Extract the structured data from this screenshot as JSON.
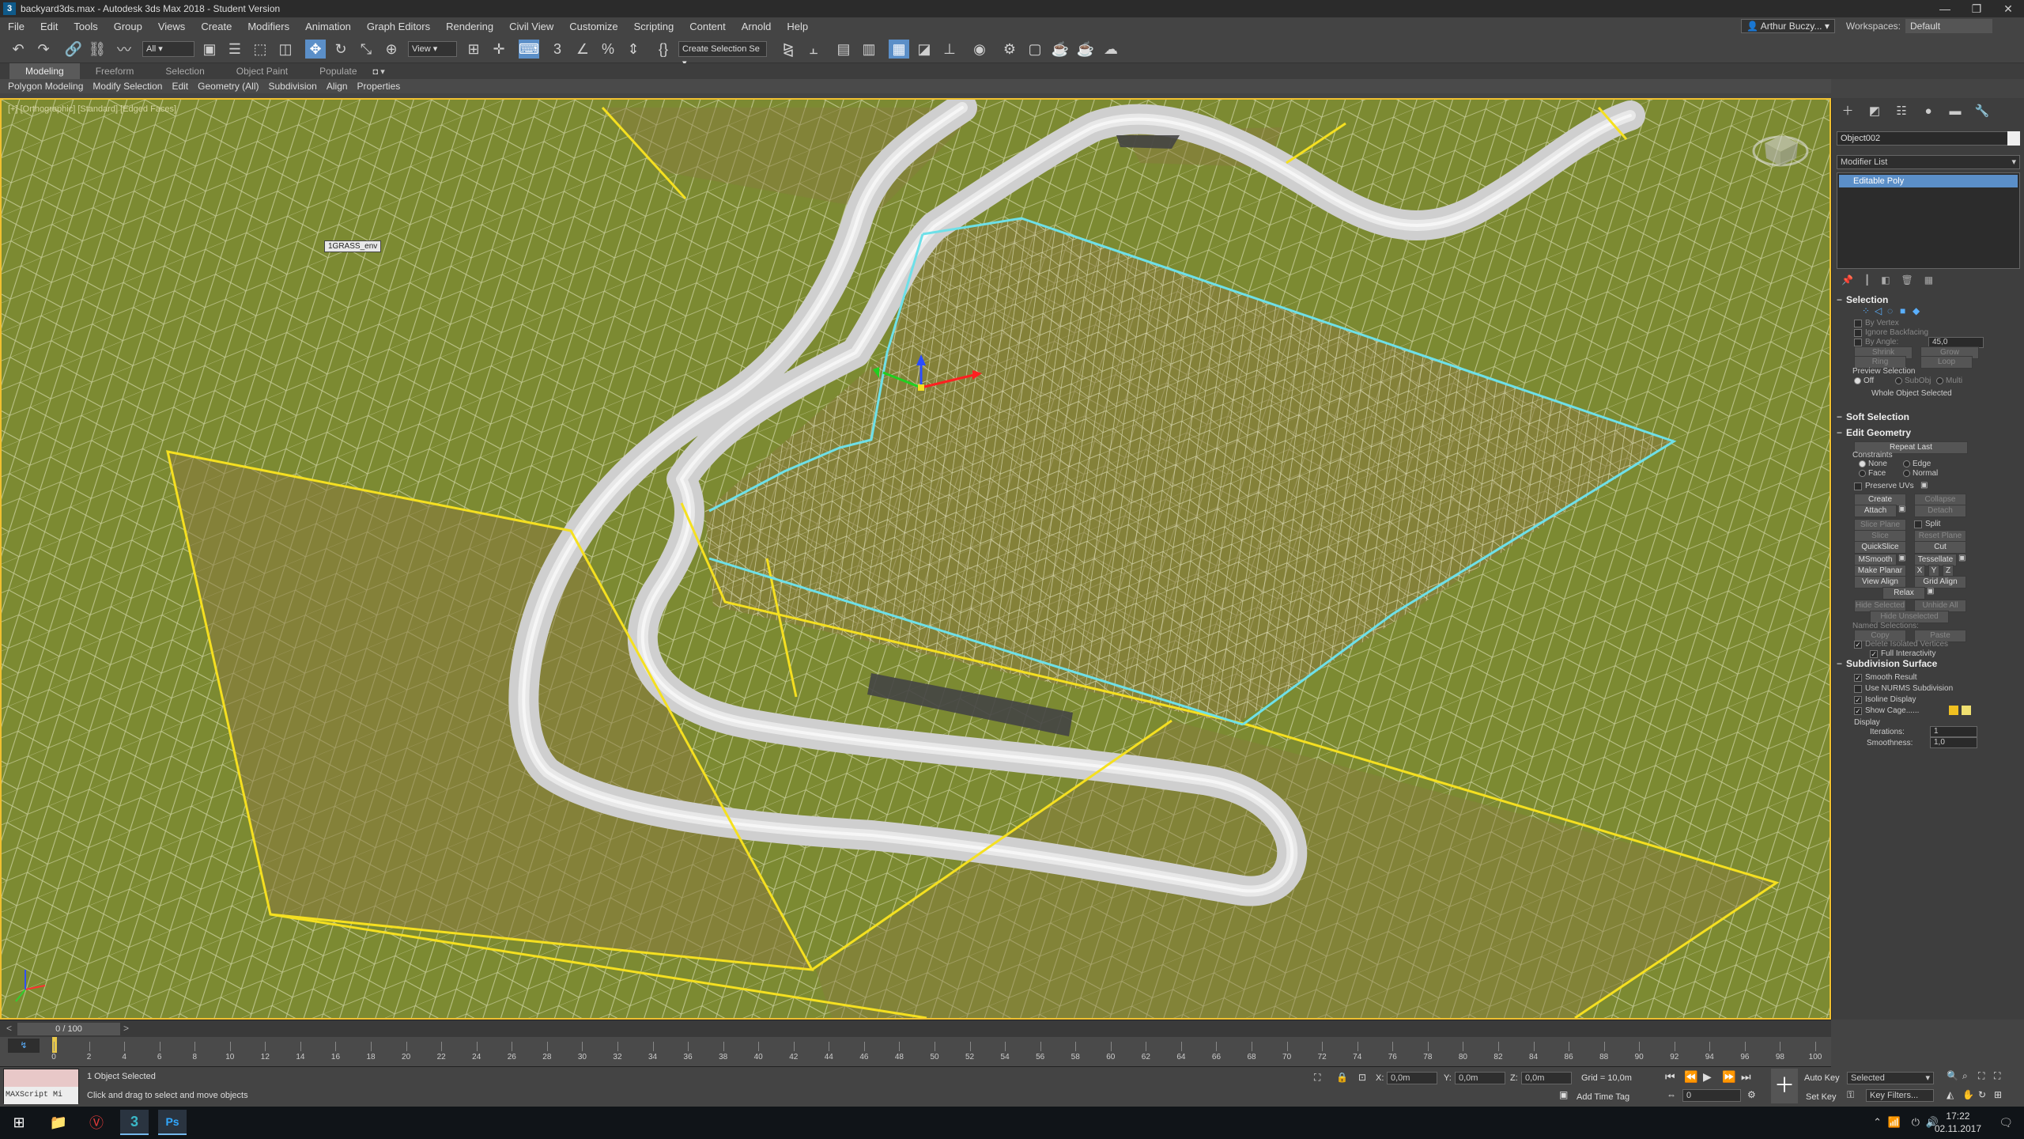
{
  "window": {
    "title": "backyard3ds.max - Autodesk 3ds Max 2018 - Student Version",
    "app_icon": "3",
    "controls": [
      "—",
      "❐",
      "✕"
    ]
  },
  "menu": {
    "items": [
      "File",
      "Edit",
      "Tools",
      "Group",
      "Views",
      "Create",
      "Modifiers",
      "Animation",
      "Graph Editors",
      "Rendering",
      "Civil View",
      "Customize",
      "Scripting",
      "Content",
      "Arnold",
      "Help"
    ],
    "user": "Arthur Buczy...",
    "workspaces_label": "Workspaces:",
    "workspaces_value": "Default"
  },
  "toolbar": {
    "filter": "All",
    "refcoord": "View",
    "selection_set": "Create Selection Se"
  },
  "ribbon": {
    "tabs": [
      "Modeling",
      "Freeform",
      "Selection",
      "Object Paint",
      "Populate"
    ],
    "buttons": [
      "Polygon Modeling",
      "Modify Selection",
      "Edit",
      "Geometry (All)",
      "Subdivision",
      "Align",
      "Properties"
    ]
  },
  "viewport": {
    "label": "[+] [Orthographic] [Standard] [Edged Faces]",
    "object_tag": "1GRASS_env",
    "bg_color": "#7c8a32",
    "selection_color": "#f5e020",
    "edge_highlight_color": "#6ee0e8"
  },
  "command_panel": {
    "object_name": "Object002",
    "modifier_list": "Modifier List",
    "stack_item": "Editable Poly",
    "selection": {
      "title": "Selection",
      "by_vertex": "By Vertex",
      "ignore_backfacing": "Ignore Backfacing",
      "by_angle": "By Angle:",
      "by_angle_value": "45,0",
      "shrink": "Shrink",
      "grow": "Grow",
      "ring": "Ring",
      "loop": "Loop",
      "preview_selection": "Preview Selection",
      "off": "Off",
      "subobj": "SubObj",
      "multi": "Multi",
      "whole_object": "Whole Object Selected"
    },
    "soft_selection": {
      "title": "Soft Selection"
    },
    "edit_geometry": {
      "title": "Edit Geometry",
      "repeat_last": "Repeat Last",
      "constraints": "Constraints",
      "none": "None",
      "edge": "Edge",
      "face": "Face",
      "normal": "Normal",
      "preserve_uvs": "Preserve UVs",
      "create": "Create",
      "collapse": "Collapse",
      "attach": "Attach",
      "detach": "Detach",
      "slice_plane": "Slice Plane",
      "split": "Split",
      "slice": "Slice",
      "reset_plane": "Reset Plane",
      "quickslice": "QuickSlice",
      "cut": "Cut",
      "msmooth": "MSmooth",
      "tessellate": "Tessellate",
      "make_planar": "Make Planar",
      "x": "X",
      "y": "Y",
      "z": "Z",
      "view_align": "View Align",
      "grid_align": "Grid Align",
      "relax": "Relax",
      "hide_selected": "Hide Selected",
      "unhide_all": "Unhide All",
      "hide_unselected": "Hide Unselected",
      "named_selections": "Named Selections:",
      "copy": "Copy",
      "paste": "Paste",
      "delete_isolated": "Delete Isolated Vertices",
      "full_interactivity": "Full Interactivity"
    },
    "subdivision": {
      "title": "Subdivision Surface",
      "smooth_result": "Smooth Result",
      "use_nurms": "Use NURMS Subdivision",
      "isoline": "Isoline Display",
      "show_cage": "Show Cage......",
      "display": "Display",
      "iterations": "Iterations:",
      "iterations_value": "1",
      "smoothness": "Smoothness:",
      "smoothness_value": "1,0",
      "cage_color1": "#f0c020",
      "cage_color2": "#f0e070"
    }
  },
  "timeline": {
    "frame": "0 / 100",
    "ticks": [
      "0",
      "2",
      "4",
      "6",
      "8",
      "10",
      "12",
      "14",
      "16",
      "18",
      "20",
      "22",
      "24",
      "26",
      "28",
      "30",
      "32",
      "34",
      "36",
      "38",
      "40",
      "42",
      "44",
      "46",
      "48",
      "50",
      "52",
      "54",
      "56",
      "58",
      "60",
      "62",
      "64",
      "66",
      "68",
      "70",
      "72",
      "74",
      "76",
      "78",
      "80",
      "82",
      "84",
      "86",
      "88",
      "90",
      "92",
      "94",
      "96",
      "98",
      "100"
    ]
  },
  "status": {
    "maxscript": "MAXScript Mi",
    "line1": "1 Object Selected",
    "line2": "Click and drag to select and move objects",
    "x_label": "X:",
    "x_value": "0,0m",
    "y_label": "Y:",
    "y_value": "0,0m",
    "z_label": "Z:",
    "z_value": "0,0m",
    "grid": "Grid = 10,0m",
    "add_time_tag": "Add Time Tag",
    "auto_key": "Auto Key",
    "selected": "Selected",
    "set_key": "Set Key",
    "key_filters": "Key Filters...",
    "frame_value": "0"
  },
  "taskbar": {
    "time": "17:22",
    "date": "02.11.2017"
  }
}
